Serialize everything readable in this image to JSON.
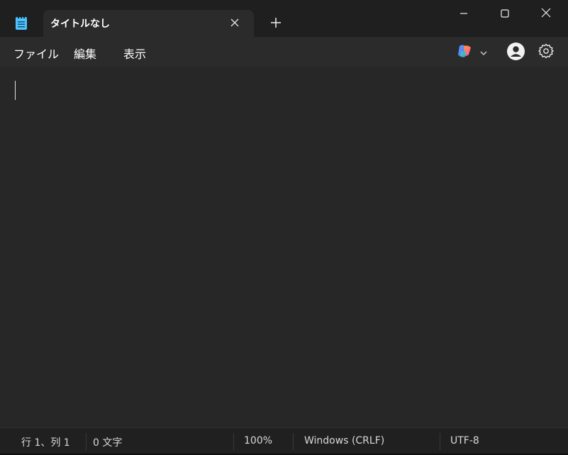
{
  "titlebar": {
    "tab_title": "タイトルなし",
    "icons": {
      "app": "notepad-icon",
      "tab_close": "close-icon",
      "new_tab": "plus-icon",
      "minimize": "minimize-icon",
      "maximize": "maximize-icon",
      "close": "close-icon"
    }
  },
  "menubar": {
    "file": "ファイル",
    "edit": "編集",
    "view": "表示",
    "icons": {
      "copilot": "copilot-icon",
      "copilot_dropdown": "chevron-down-icon",
      "account": "account-icon",
      "settings": "gear-icon"
    }
  },
  "editor": {
    "content": ""
  },
  "statusbar": {
    "position": "行 1、列 1",
    "char_count": "0 文字",
    "zoom": "100%",
    "line_ending": "Windows (CRLF)",
    "encoding": "UTF-8"
  },
  "colors": {
    "window_bg": "#272727",
    "titlebar_bg": "#1f1f1f",
    "tab_bg": "#2b2b2b",
    "statusbar_bg": "#202020",
    "text": "#ffffff",
    "app_icon_blue": "#4cc2ff"
  }
}
